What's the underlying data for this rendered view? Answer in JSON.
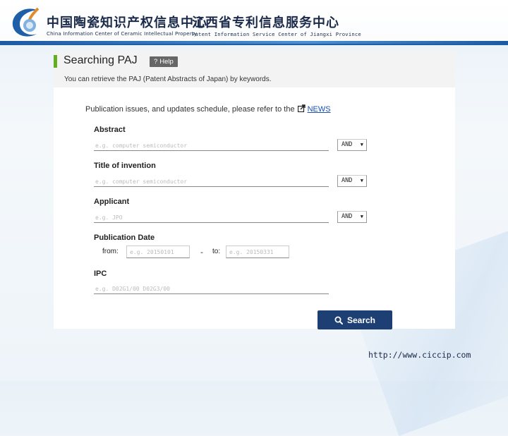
{
  "header": {
    "title_cn_1": "中国陶瓷知识产权信息中心",
    "subtitle_en_1": "China Information Center of Ceramic Intellectual Property",
    "title_cn_2": "江西省专利信息服务中心",
    "subtitle_en_2": "Patent Information Service Center of  Jiangxi  Province",
    "brand_color": "#1f5fa8"
  },
  "panel": {
    "title": "Searching PAJ",
    "help_label": "Help",
    "description": "You can retrieve the PAJ (Patent Abstracts of Japan) by keywords."
  },
  "news": {
    "text": "Publication issues, and updates schedule, please refer to the",
    "link": "NEWS"
  },
  "fields": {
    "abstract": {
      "label": "Abstract",
      "placeholder": "e.g. computer semiconductor",
      "operator": "AND"
    },
    "title": {
      "label": "Title of invention",
      "placeholder": "e.g. computer semiconductor",
      "operator": "AND"
    },
    "applicant": {
      "label": "Applicant",
      "placeholder": "e.g. JPO",
      "operator": "AND"
    },
    "pubdate": {
      "label": "Publication Date",
      "from_label": "from:",
      "from_placeholder": "e.g. 20150101",
      "dash": "-",
      "to_label": "to:",
      "to_placeholder": "e.g. 20150331"
    },
    "ipc": {
      "label": "IPC",
      "placeholder": "e.g. D02G1/00 D02G3/00"
    }
  },
  "search_button": {
    "label": "Search"
  },
  "footer": {
    "url": "http://www.ciccip.com"
  },
  "icons": [
    "logo-icon",
    "help-question-icon",
    "external-link-icon",
    "select-arrow-icon",
    "magnifier-icon"
  ]
}
